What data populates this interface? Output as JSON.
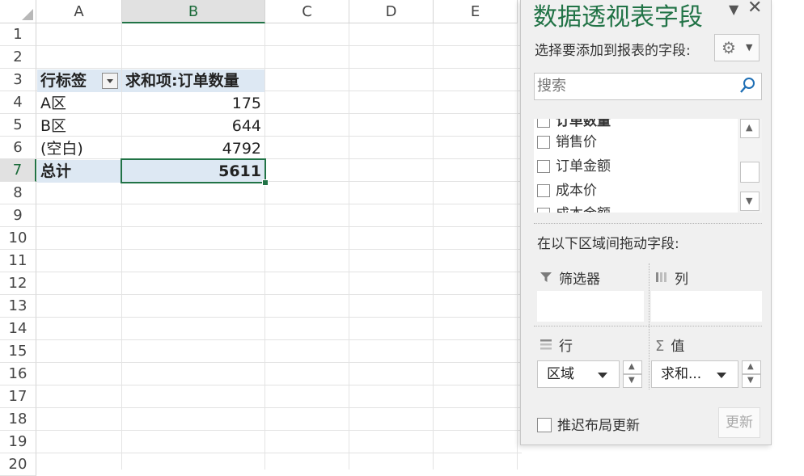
{
  "sheet": {
    "columns": [
      "A",
      "B",
      "C",
      "D",
      "E"
    ],
    "rows": [
      "1",
      "2",
      "3",
      "4",
      "5",
      "6",
      "7",
      "8",
      "9",
      "10",
      "11",
      "12",
      "13",
      "14",
      "15",
      "16",
      "17",
      "18",
      "19",
      "20"
    ],
    "pivot": {
      "header_row_label": "行标签",
      "header_value_label": "求和项:订单数量",
      "rows": [
        {
          "label": "A区",
          "value": "175"
        },
        {
          "label": "B区",
          "value": "644"
        },
        {
          "label": "(空白)",
          "value": "4792"
        }
      ],
      "total": {
        "label": "总计",
        "value": "5611"
      }
    }
  },
  "pivot_panel": {
    "title": "数据透视表字段",
    "choose_fields_label": "选择要添加到报表的字段:",
    "search_placeholder": "搜索",
    "fields": [
      {
        "label": "订单数量",
        "checked": true
      },
      {
        "label": "销售价",
        "checked": false
      },
      {
        "label": "订单金额",
        "checked": false
      },
      {
        "label": "成本价",
        "checked": false
      },
      {
        "label": "成本金额",
        "checked": false
      }
    ],
    "drag_label": "在以下区域间拖动字段:",
    "areas": {
      "filters": "筛选器",
      "columns": "列",
      "rows": "行",
      "values": "值"
    },
    "rows_field": "区域",
    "values_field": "求和...",
    "defer_label": "推迟布局更新",
    "update_button": "更新"
  }
}
